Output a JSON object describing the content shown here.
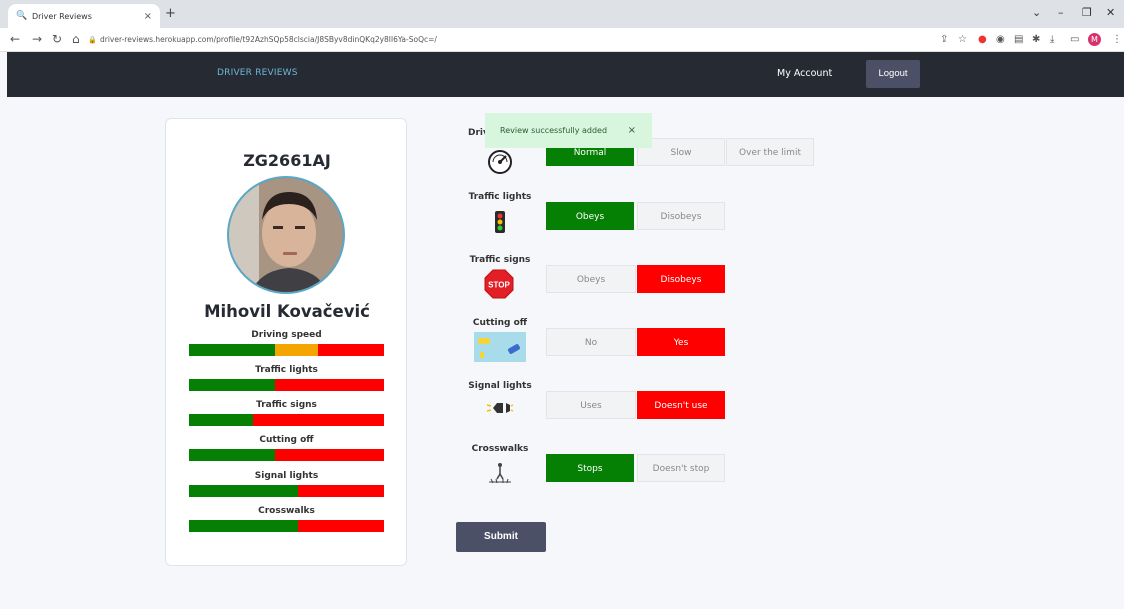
{
  "browser": {
    "tab_title": "Driver Reviews",
    "url": "driver-reviews.herokuapp.com/profile/t92AzhSQp58clscia/J8SByv8dinQKq2y8Il6Ya-SoQc=/",
    "profile_initial": "M"
  },
  "header": {
    "brand": "DRIVER REVIEWS",
    "account": "My Account",
    "logout": "Logout"
  },
  "profile": {
    "plate": "ZG2661AJ",
    "name": "Mihovil Kovačević",
    "metrics": [
      {
        "label": "Driving speed",
        "green": 0.44,
        "orange": 0.22,
        "red": 0.34
      },
      {
        "label": "Traffic lights",
        "green": 0.44,
        "orange": 0,
        "red": 0.56
      },
      {
        "label": "Traffic signs",
        "green": 0.33,
        "orange": 0,
        "red": 0.67
      },
      {
        "label": "Cutting off",
        "green": 0.44,
        "orange": 0,
        "red": 0.56
      },
      {
        "label": "Signal lights",
        "green": 0.56,
        "orange": 0,
        "red": 0.44
      },
      {
        "label": "Crosswalks",
        "green": 0.56,
        "orange": 0,
        "red": 0.44
      }
    ]
  },
  "form": {
    "rows": [
      {
        "label": "Driv",
        "options": [
          {
            "text": "Normal",
            "state": "green"
          },
          {
            "text": "Slow",
            "state": "none"
          },
          {
            "text": "Over the limit",
            "state": "none"
          }
        ]
      },
      {
        "label": "Traffic lights",
        "options": [
          {
            "text": "Obeys",
            "state": "green"
          },
          {
            "text": "Disobeys",
            "state": "none"
          }
        ]
      },
      {
        "label": "Traffic signs",
        "options": [
          {
            "text": "Obeys",
            "state": "none"
          },
          {
            "text": "Disobeys",
            "state": "red"
          }
        ]
      },
      {
        "label": "Cutting off",
        "options": [
          {
            "text": "No",
            "state": "none"
          },
          {
            "text": "Yes",
            "state": "red"
          }
        ]
      },
      {
        "label": "Signal lights",
        "options": [
          {
            "text": "Uses",
            "state": "none"
          },
          {
            "text": "Doesn't use",
            "state": "red"
          }
        ]
      },
      {
        "label": "Crosswalks",
        "options": [
          {
            "text": "Stops",
            "state": "green"
          },
          {
            "text": "Doesn't stop",
            "state": "none"
          }
        ]
      }
    ],
    "submit": "Submit"
  },
  "toast": {
    "message": "Review successfully added",
    "close": "×"
  },
  "colors": {
    "green": "#058005",
    "orange": "#f5a500",
    "red": "#fe0000",
    "header_bg": "#262a33",
    "button_bg": "#4c5066"
  }
}
